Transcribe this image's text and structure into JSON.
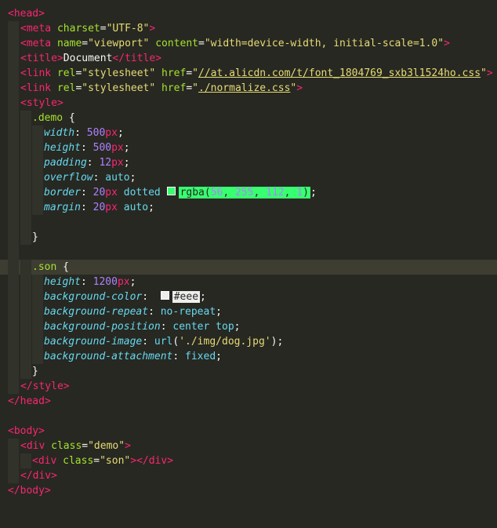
{
  "editor": {
    "theme_colors": {
      "background": "#272822",
      "current_line": "#3e3d32",
      "tag": "#f92672",
      "attribute": "#a6e22e",
      "string": "#e6db74",
      "property": "#66d9ef",
      "number": "#ae81ff"
    },
    "lines": {
      "l01": {
        "tag": "head"
      },
      "l02": {
        "tag": "meta",
        "a1": "charset",
        "v1": "\"UTF-8\""
      },
      "l03": {
        "tag": "meta",
        "a1": "name",
        "v1": "\"viewport\"",
        "a2": "content",
        "v2": "\"width=device-width, initial-scale=1.0\""
      },
      "l04": {
        "tag": "title",
        "text": "Document",
        "close": "title"
      },
      "l05": {
        "tag": "link",
        "a1": "rel",
        "v1": "\"stylesheet\"",
        "a2": "href",
        "v2_q1": "\"",
        "v2_url": "//at.alicdn.com/t/font_1804769_sxb3l1524ho.css",
        "v2_q2": "\""
      },
      "l06": {
        "tag": "link",
        "a1": "rel",
        "v1": "\"stylesheet\"",
        "a2": "href",
        "v2_q1": "\"",
        "v2_url": "./normalize.css",
        "v2_q2": "\""
      },
      "l07": {
        "tag": "style"
      },
      "l08": {
        "selector": ".demo"
      },
      "l09": {
        "prop": "width",
        "num": "500",
        "unit": "px"
      },
      "l10": {
        "prop": "height",
        "num": "500",
        "unit": "px"
      },
      "l11": {
        "prop": "padding",
        "num": "12",
        "unit": "px"
      },
      "l12": {
        "prop": "overflow",
        "value": "auto"
      },
      "l13": {
        "prop": "border",
        "num": "20",
        "unit": "px",
        "value": "dotted",
        "color_fn": "rgba(",
        "c1": "56",
        "c2": "255",
        "c3": "112",
        "c4": "1",
        "color_end": ")",
        "swatch": "#38ff70"
      },
      "l14": {
        "prop": "margin",
        "num": "20",
        "unit": "px",
        "value": "auto"
      },
      "l17": {
        "selector": ".son"
      },
      "l18": {
        "prop": "height",
        "num": "1200",
        "unit": "px"
      },
      "l19": {
        "prop": "background-color",
        "color": "#eee",
        "swatch": "#eeeeee"
      },
      "l20": {
        "prop": "background-repeat",
        "value": "no-repeat"
      },
      "l21": {
        "prop": "background-position",
        "value": "center top"
      },
      "l22": {
        "prop": "background-image",
        "fn": "url",
        "arg": "'./img/dog.jpg'"
      },
      "l23": {
        "prop": "background-attachment",
        "value": "fixed"
      },
      "l25": {
        "close": "style"
      },
      "l26": {
        "close": "head"
      },
      "l28": {
        "tag": "body"
      },
      "l29": {
        "tag": "div",
        "a1": "class",
        "v1": "\"demo\""
      },
      "l30": {
        "tag": "div",
        "a1": "class",
        "v1": "\"son\"",
        "close": "div"
      },
      "l31": {
        "close": "div"
      },
      "l32": {
        "close": "body"
      }
    },
    "punctuation": {
      "lt": "<",
      "gt": ">",
      "lt_slash": "</",
      "eq": "=",
      "colon": ":",
      "semi": ";",
      "open_brace": " {",
      "close_brace": "}",
      "comma": ", ",
      "lparen": "(",
      "rparen": ")"
    }
  }
}
